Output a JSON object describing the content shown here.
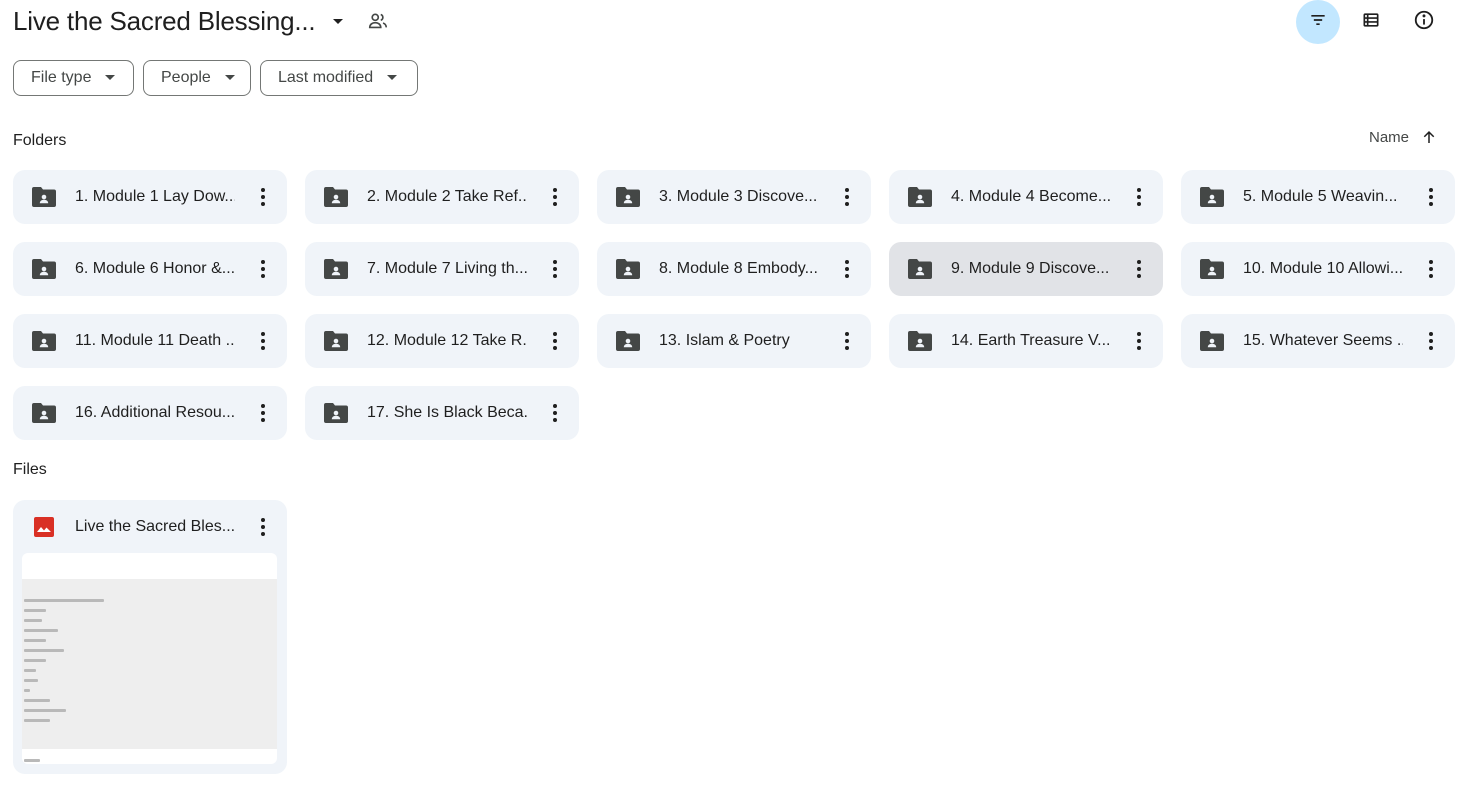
{
  "header": {
    "title": "Live the Sacred Blessing...",
    "caret_icon": "arrow-drop-down-icon",
    "share_icon": "people-icon",
    "actions": [
      {
        "name": "filter-button",
        "icon": "filter-icon",
        "active": true
      },
      {
        "name": "list-view-button",
        "icon": "list-view-icon",
        "active": false
      },
      {
        "name": "details-button",
        "icon": "info-icon",
        "active": false
      }
    ]
  },
  "filters": [
    {
      "label": "File type"
    },
    {
      "label": "People"
    },
    {
      "label": "Last modified"
    }
  ],
  "folders_section": {
    "label": "Folders",
    "sort": {
      "label": "Name",
      "direction": "ascending"
    },
    "items": [
      {
        "name": "1. Module 1 Lay Dow..."
      },
      {
        "name": "2. Module 2 Take Ref..."
      },
      {
        "name": "3. Module 3 Discove..."
      },
      {
        "name": "4. Module 4 Become..."
      },
      {
        "name": "5. Module 5 Weavin..."
      },
      {
        "name": "6. Module 6 Honor &..."
      },
      {
        "name": "7. Module 7 Living th..."
      },
      {
        "name": "8. Module 8 Embody..."
      },
      {
        "name": "9. Module 9 Discove...",
        "selected": true
      },
      {
        "name": "10. Module 10 Allowi..."
      },
      {
        "name": "11. Module 11 Death ..."
      },
      {
        "name": "12. Module 12 Take R..."
      },
      {
        "name": "13. Islam & Poetry"
      },
      {
        "name": "14. Earth Treasure V..."
      },
      {
        "name": "15. Whatever Seems ..."
      },
      {
        "name": "16. Additional Resou..."
      },
      {
        "name": "17. She Is Black Beca..."
      }
    ]
  },
  "files_section": {
    "label": "Files",
    "items": [
      {
        "name": "Live the Sacred Bles...",
        "icon": "image-file-icon"
      }
    ]
  },
  "colors": {
    "folder_bg": "#f0f4f9",
    "folder_selected_bg": "#e1e3e7",
    "active_button_bg": "#c2e7ff",
    "image_icon": "#d93025",
    "icon_gray": "#444746"
  }
}
